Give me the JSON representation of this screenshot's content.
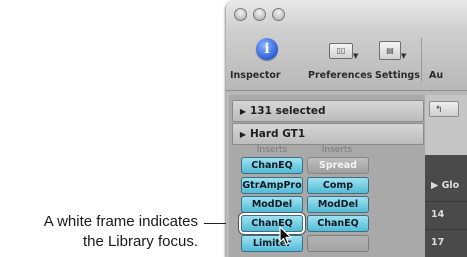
{
  "callout": {
    "line1": "A white frame indicates",
    "line2": "the Library focus."
  },
  "toolbar": {
    "inspector_label": "Inspector",
    "preferences_label": "Preferences",
    "settings_label": "Settings",
    "truncated_label": "Au"
  },
  "inspector": {
    "region1_label": "131 selected",
    "region2_label": "Hard GT1",
    "col1_header": "Inserts",
    "col2_header": "Inserts",
    "col1_slots": [
      "ChanEQ",
      "GtrAmpPro",
      "ModDel",
      "ChanEQ",
      "Limiter"
    ],
    "col2_slots": [
      "Spread",
      "Comp",
      "ModDel",
      "ChanEQ",
      ""
    ]
  },
  "right_pane": {
    "button_label": "↰",
    "row1": "▶ Glo",
    "row2": "14",
    "row3": "17"
  },
  "colors": {
    "active_slot": "#52bcd7",
    "inactive_slot": "#a9a9a9",
    "focus_frame": "#ffffff"
  }
}
